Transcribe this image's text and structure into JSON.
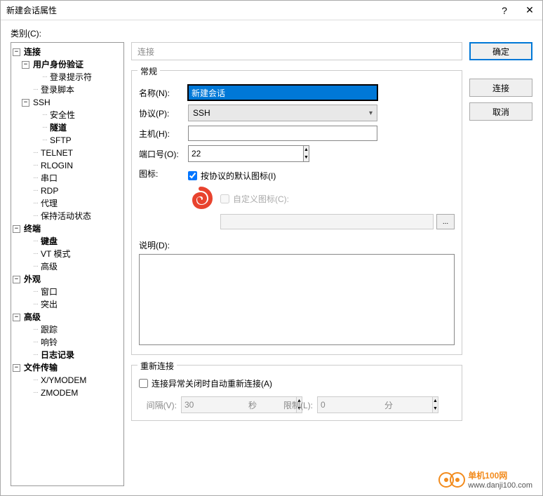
{
  "title": "新建会话属性",
  "category_label": "类别(C):",
  "tree": {
    "connection": "连接",
    "user_auth": "用户身份验证",
    "login_prompt": "登录提示符",
    "login_script": "登录脚本",
    "ssh": "SSH",
    "security": "安全性",
    "tunnel": "隧道",
    "sftp": "SFTP",
    "telnet": "TELNET",
    "rlogin": "RLOGIN",
    "serial": "串口",
    "rdp": "RDP",
    "proxy": "代理",
    "keepalive": "保持活动状态",
    "terminal": "终端",
    "keyboard": "键盘",
    "vt_mode": "VT 模式",
    "term_adv": "高级",
    "appearance": "外观",
    "window": "窗口",
    "highlight": "突出",
    "advanced": "高级",
    "trace": "跟踪",
    "bell": "响铃",
    "logging": "日志记录",
    "file_transfer": "文件传输",
    "xymodem": "X/YMODEM",
    "zmodem": "ZMODEM"
  },
  "header": "连接",
  "group_general": "常规",
  "labels": {
    "name": "名称(N):",
    "protocol": "协议(P):",
    "host": "主机(H):",
    "port": "端口号(O):",
    "icon": "图标:",
    "default_icon": "按协议的默认图标(I)",
    "custom_icon": "自定义图标(C):",
    "description": "说明(D):",
    "browse": "..."
  },
  "values": {
    "name": "新建会话",
    "protocol": "SSH",
    "host": "",
    "port": "22",
    "default_icon_checked": true,
    "custom_icon_checked": false,
    "description": ""
  },
  "group_reconnect": "重新连接",
  "reconnect": {
    "auto_label": "连接异常关闭时自动重新连接(A)",
    "auto_checked": false,
    "interval_label": "间隔(V):",
    "interval_value": "30",
    "interval_unit": "秒",
    "limit_label": "限制(L):",
    "limit_value": "0",
    "limit_unit": "分"
  },
  "buttons": {
    "ok": "确定",
    "connect": "连接",
    "cancel": "取消"
  },
  "watermark": {
    "brand": "单机100网",
    "url": "www.danji100.com"
  }
}
